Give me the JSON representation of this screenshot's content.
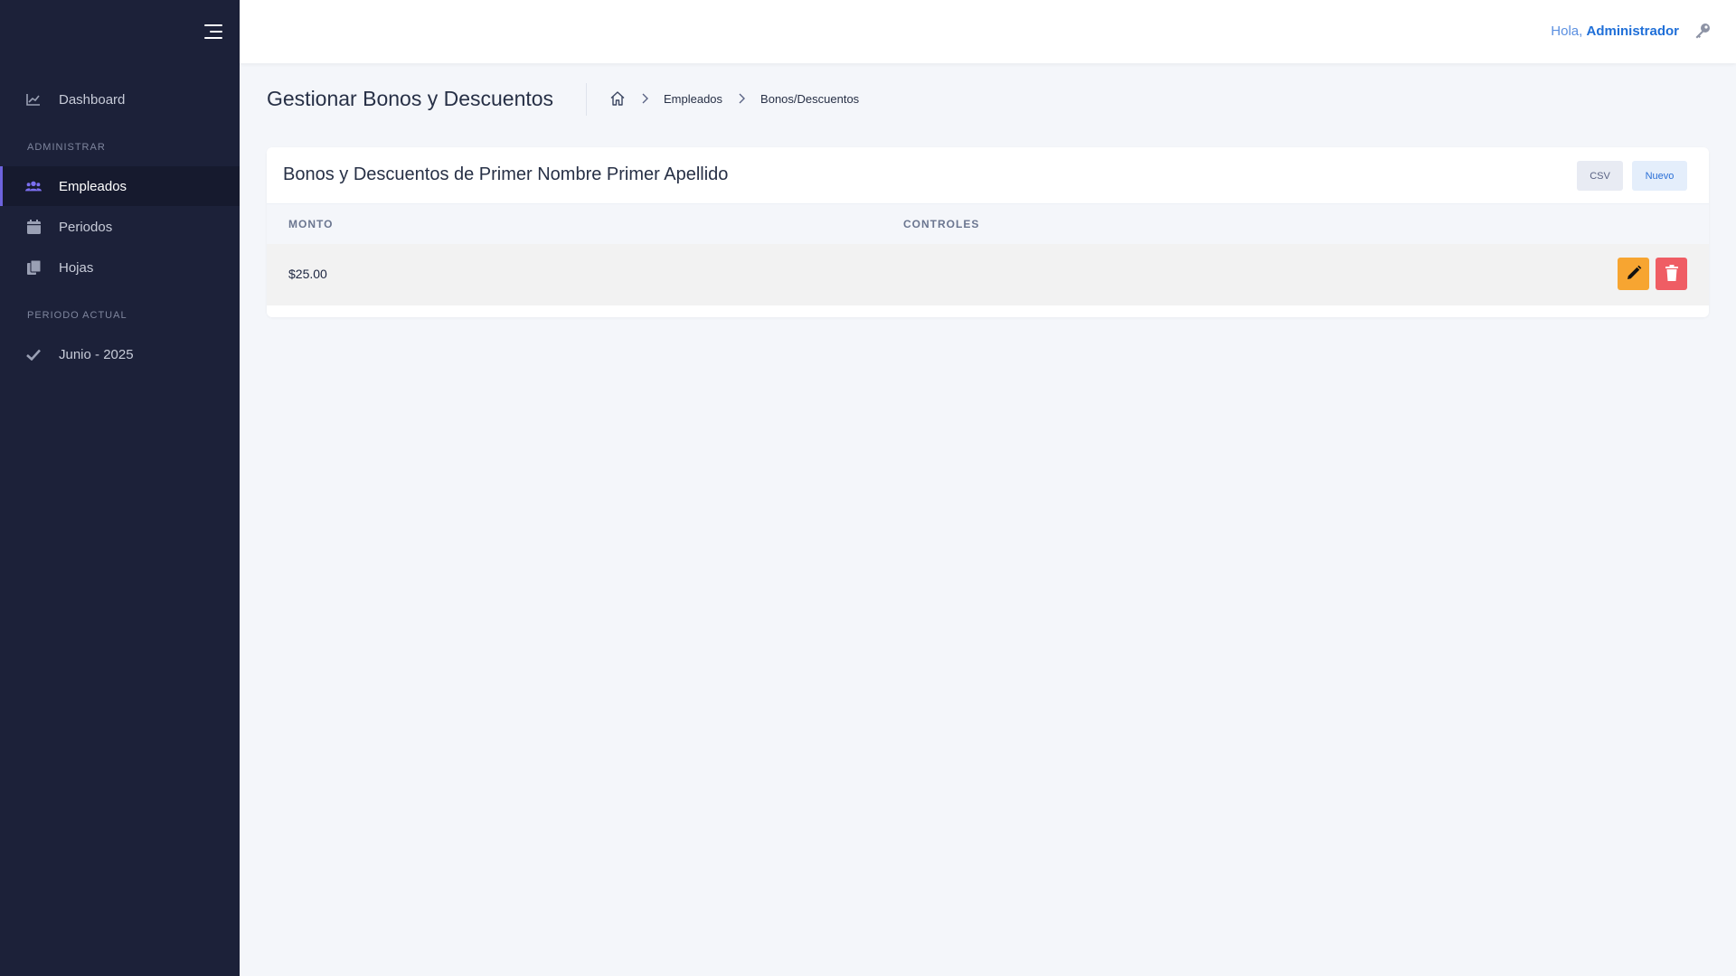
{
  "sidebar": {
    "items": [
      {
        "label": "Dashboard",
        "icon": "chart-line-icon"
      },
      {
        "label": "Empleados",
        "icon": "users-icon",
        "active": true
      },
      {
        "label": "Periodos",
        "icon": "calendar-icon"
      },
      {
        "label": "Hojas",
        "icon": "copy-icon"
      },
      {
        "label": "Junio - 2025",
        "icon": "check-icon"
      }
    ],
    "sections": {
      "administrar": "ADMINISTRAR",
      "periodo_actual": "PERIODO ACTUAL"
    }
  },
  "header": {
    "greeting": "Hola,",
    "user": "Administrador"
  },
  "page": {
    "title": "Gestionar Bonos y Descuentos",
    "breadcrumb": [
      "Empleados",
      "Bonos/Descuentos"
    ]
  },
  "card": {
    "title": "Bonos y Descuentos de Primer Nombre Primer Apellido",
    "csv_label": "CSV",
    "new_label": "Nuevo",
    "columns": [
      "MONTO",
      "CONTROLES"
    ],
    "rows": [
      {
        "monto": "$25.00"
      }
    ]
  },
  "colors": {
    "sidebar_bg": "#1c2139",
    "accent": "#6d63dd",
    "edit": "#f7a531",
    "delete": "#ef5d64",
    "link": "#1f6fd8"
  }
}
